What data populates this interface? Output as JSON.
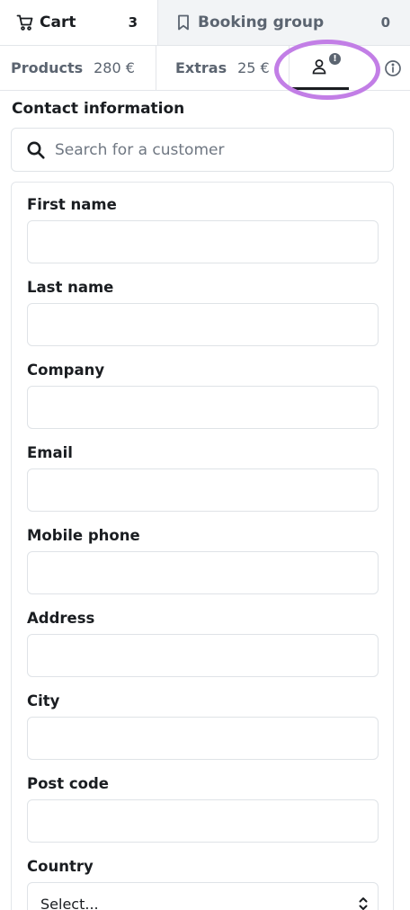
{
  "top_tabs": {
    "cart": {
      "label": "Cart",
      "count": "3"
    },
    "booking_group": {
      "label": "Booking group",
      "count": "0"
    }
  },
  "sub_tabs": {
    "products": {
      "label": "Products",
      "price": "280 €"
    },
    "extras": {
      "label": "Extras",
      "price": "25 €"
    },
    "contact_alert": "!"
  },
  "contact": {
    "title": "Contact information",
    "search_placeholder": "Search for a customer"
  },
  "form": {
    "first_name": "First name",
    "last_name": "Last name",
    "company": "Company",
    "email": "Email",
    "mobile_phone": "Mobile phone",
    "address": "Address",
    "city": "City",
    "post_code": "Post code",
    "country": "Country",
    "country_value": "Select..."
  },
  "colors": {
    "highlight": "#c27ee6",
    "border": "#e3e6ea",
    "muted": "#5b6470"
  }
}
